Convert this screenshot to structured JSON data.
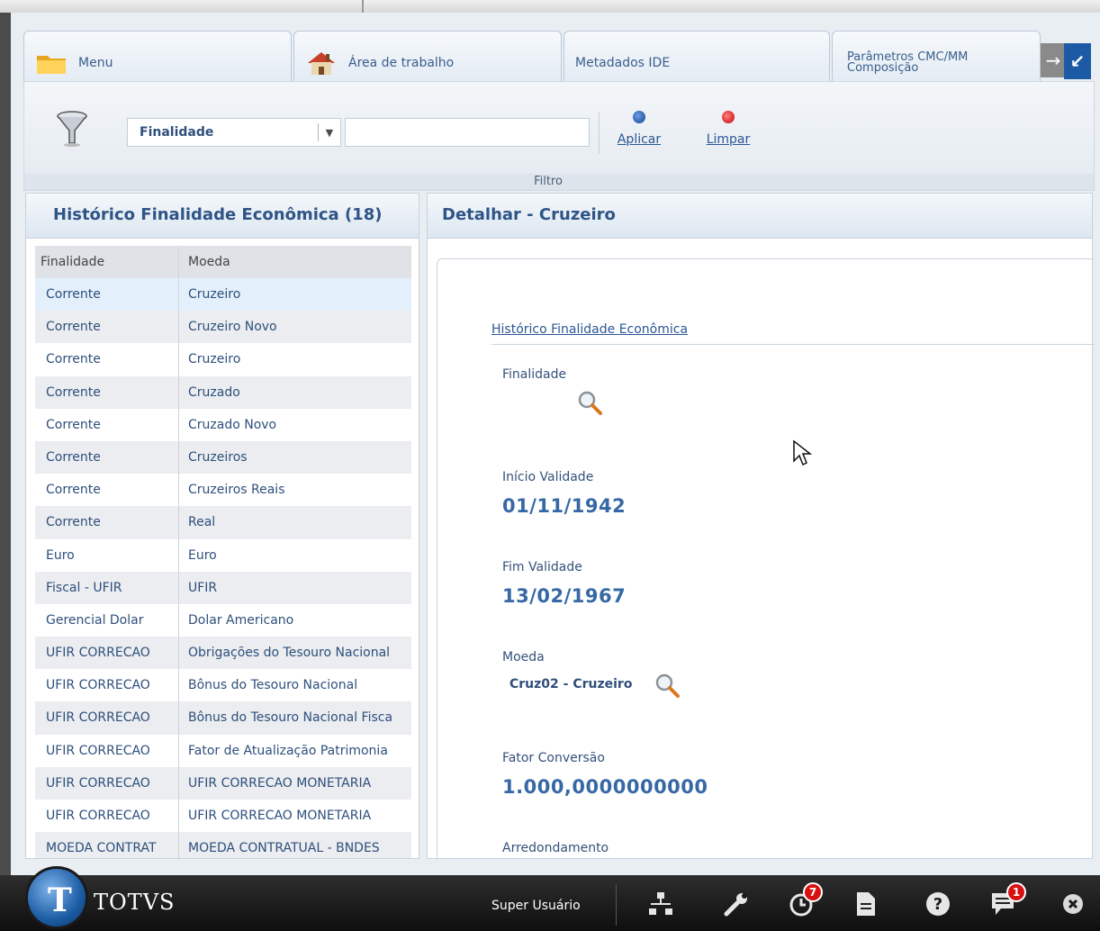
{
  "tabs": [
    {
      "label": "Menu",
      "icon": "folder-icon"
    },
    {
      "label": "Área de trabalho",
      "icon": "house-icon"
    },
    {
      "label": "Metadados IDE"
    },
    {
      "label_line1": "Parâmetros CMC/MM",
      "label_line2": "Composição"
    }
  ],
  "filter": {
    "select_value": "Finalidade",
    "input_value": "",
    "apply_label": "Aplicar",
    "clear_label": "Limpar",
    "caption": "Filtro"
  },
  "history": {
    "title": "Histórico Finalidade Econômica (18)",
    "columns": [
      "Finalidade",
      "Moeda"
    ],
    "rows": [
      [
        "Corrente",
        "Cruzeiro"
      ],
      [
        "Corrente",
        "Cruzeiro Novo"
      ],
      [
        "Corrente",
        "Cruzeiro"
      ],
      [
        "Corrente",
        "Cruzado"
      ],
      [
        "Corrente",
        "Cruzado Novo"
      ],
      [
        "Corrente",
        "Cruzeiros"
      ],
      [
        "Corrente",
        "Cruzeiros Reais"
      ],
      [
        "Corrente",
        "Real"
      ],
      [
        "Euro",
        "Euro"
      ],
      [
        "Fiscal - UFIR",
        "UFIR"
      ],
      [
        "Gerencial Dolar",
        "Dolar Americano"
      ],
      [
        "UFIR CORRECAO",
        "Obrigações do Tesouro Nacional"
      ],
      [
        "UFIR CORRECAO",
        "Bônus do Tesouro Nacional"
      ],
      [
        "UFIR CORRECAO",
        "Bônus do Tesouro Nacional Fisca"
      ],
      [
        "UFIR CORRECAO",
        "Fator de Atualização Patrimonia"
      ],
      [
        "UFIR CORRECAO",
        "UFIR CORRECAO MONETARIA"
      ],
      [
        "UFIR CORRECAO",
        "UFIR CORRECAO MONETARIA"
      ],
      [
        "MOEDA CONTRAT",
        "MOEDA CONTRATUAL - BNDES"
      ]
    ],
    "selected_index": 0
  },
  "detail": {
    "title": "Detalhar - Cruzeiro",
    "section_link": "Histórico Finalidade Econômica",
    "finalidade_label": "Finalidade",
    "inicio_label": "Início Validade",
    "inicio_value": "01/11/1942",
    "fim_label": "Fim Validade",
    "fim_value": "13/02/1967",
    "moeda_label": "Moeda",
    "moeda_value": "Cruz02 - Cruzeiro",
    "fator_label": "Fator Conversão",
    "fator_value": "1.000,0000000000",
    "arred_label": "Arredondamento"
  },
  "taskbar": {
    "brand": "TOTVS",
    "user": "Super Usuário",
    "tasks_badge": "7",
    "messages_badge": "1"
  },
  "colors": {
    "accent": "#2f5486",
    "selected_row": "#e3f0fb",
    "badge": "#d71010"
  }
}
